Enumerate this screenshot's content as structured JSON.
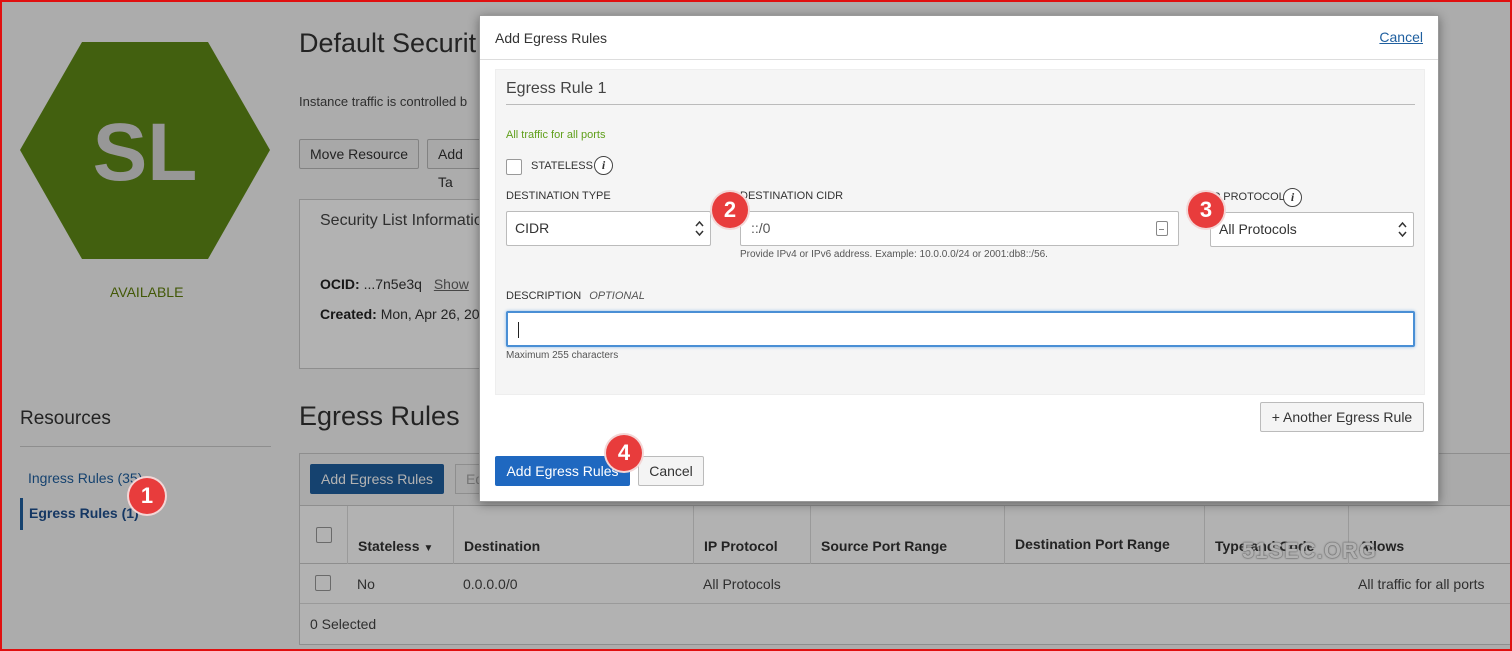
{
  "logo": {
    "initials": "SL",
    "color": "#5f8a16"
  },
  "status": "AVAILABLE",
  "page": {
    "title": "Default Securit",
    "intro": "Instance traffic is controlled b",
    "buttons": [
      "Move Resource",
      "Add Ta"
    ]
  },
  "info_box": {
    "title": "Security List Informatio",
    "ocid_label": "OCID:",
    "ocid_value": "...7n5e3q",
    "show_link": "Show",
    "created_label": "Created:",
    "created_value": "Mon, Apr 26, 20"
  },
  "resources": {
    "title": "Resources",
    "ingress": "Ingress Rules (35)",
    "egress": "Egress Rules (1)"
  },
  "egress_section": {
    "title": "Egress Rules",
    "add_button": "Add Egress Rules",
    "edit_button": "Ed",
    "columns": [
      "Stateless",
      "Destination",
      "IP Protocol",
      "Source Port Range",
      "Destination Port Range",
      "Type and Code",
      "Allows"
    ],
    "rows": [
      {
        "stateless": "No",
        "destination": "0.0.0.0/0",
        "ip_protocol": "All Protocols",
        "allows": "All traffic for all ports"
      }
    ],
    "footer": "0 Selected"
  },
  "watermark": "51SEC.ORG",
  "modal": {
    "title": "Add Egress Rules",
    "cancel_link": "Cancel",
    "rule_title": "Egress Rule 1",
    "hint": "All traffic for all ports",
    "stateless_label": "STATELESS",
    "dest_type_label": "DESTINATION TYPE",
    "dest_type_value": "CIDR",
    "dest_cidr_label": "DESTINATION CIDR",
    "dest_cidr_value": "::/0",
    "dest_cidr_help": "Provide IPv4 or IPv6 address. Example: 10.0.0.0/24 or 2001:db8::/56.",
    "ip_protocol_label": "IP PROTOCOL",
    "ip_protocol_value": "All Protocols",
    "description_label": "DESCRIPTION",
    "description_optional": "OPTIONAL",
    "description_value": "",
    "description_help": "Maximum 255 characters",
    "another_button": "+ Another Egress Rule",
    "add_button": "Add Egress Rules",
    "cancel_button": "Cancel"
  },
  "badges": [
    "1",
    "2",
    "3",
    "4"
  ],
  "colors": {
    "primary": "#1f68c0",
    "frame": "#e01010",
    "badge": "#e83c3c",
    "hint_green": "#5f9f1a"
  }
}
